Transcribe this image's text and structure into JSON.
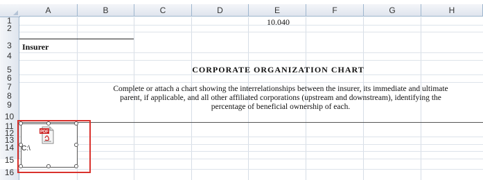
{
  "spreadsheet": {
    "columns": [
      "A",
      "B",
      "C",
      "D",
      "E",
      "F",
      "G",
      "H"
    ],
    "rows": [
      "1",
      "2",
      "3",
      "4",
      "5",
      "6",
      "7",
      "8",
      "9",
      "10",
      "11",
      "12",
      "13",
      "14",
      "15",
      "16"
    ],
    "cells": {
      "E1": "10.040",
      "A3": "Insurer",
      "title": "CORPORATE ORGANIZATION CHART",
      "instruction_line1": "Complete or attach a chart showing the interrelationships between the insurer, its immediate and ultimate",
      "instruction_line2": "parent, if applicable, and all other affiliated corporations (upstream and downstream), identifying the",
      "instruction_line3": "percentage of beneficial ownership of each."
    },
    "embedded_object": {
      "icon_badge": "PDF",
      "label": "C:\\"
    }
  }
}
